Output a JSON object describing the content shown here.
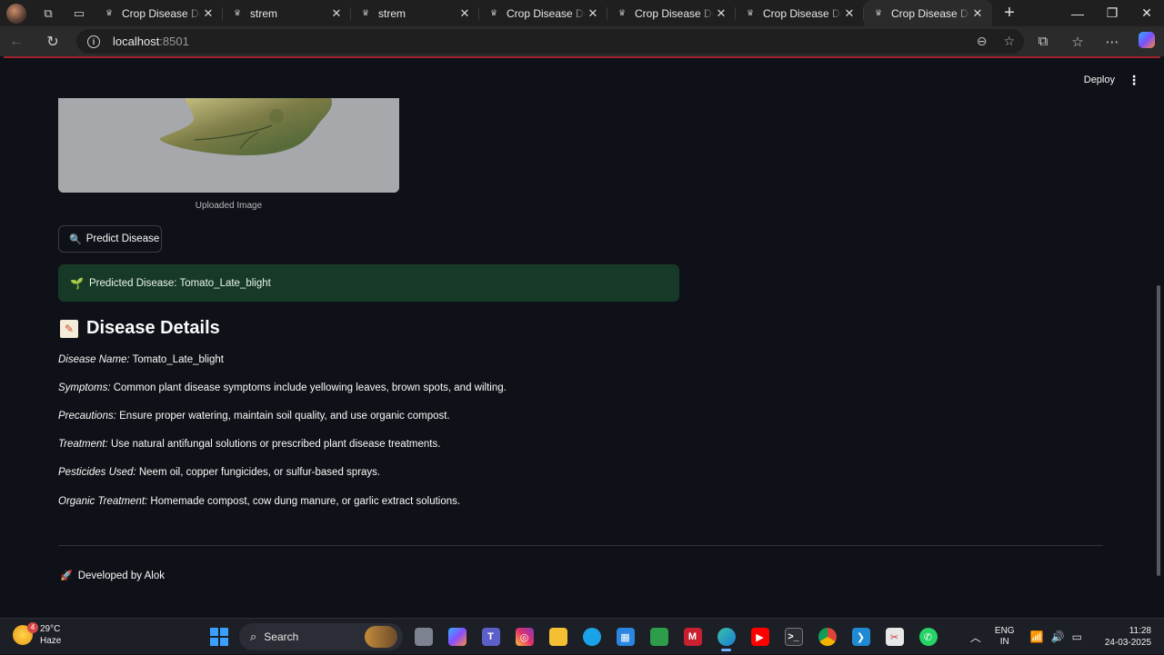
{
  "browser": {
    "tabs": [
      {
        "title": "Crop Disease Detecti",
        "active": false
      },
      {
        "title": "strem",
        "active": false
      },
      {
        "title": "strem",
        "active": false
      },
      {
        "title": "Crop Disease Detecti",
        "active": false
      },
      {
        "title": "Crop Disease Detecti",
        "active": false
      },
      {
        "title": "Crop Disease Detecti",
        "active": false
      },
      {
        "title": "Crop Disease Detecti",
        "active": true
      }
    ],
    "url_host": "localhost",
    "url_port": ":8501"
  },
  "app": {
    "toolbar": {
      "deploy_label": "Deploy"
    },
    "image_caption": "Uploaded Image",
    "predict_button_label": "Predict Disease",
    "prediction_text": "Predicted Disease: Tomato_Late_blight",
    "details_heading": "Disease Details",
    "details": [
      {
        "key": "Disease Name:",
        "value": " Tomato_Late_blight"
      },
      {
        "key": "Symptoms:",
        "value": " Common plant disease symptoms include yellowing leaves, brown spots, and wilting."
      },
      {
        "key": "Precautions:",
        "value": " Ensure proper watering, maintain soil quality, and use organic compost."
      },
      {
        "key": "Treatment:",
        "value": " Use natural antifungal solutions or prescribed plant disease treatments."
      },
      {
        "key": "Pesticides Used:",
        "value": " Neem oil, copper fungicides, or sulfur-based sprays."
      },
      {
        "key": "Organic Treatment:",
        "value": " Homemade compost, cow dung manure, or garlic extract solutions."
      }
    ],
    "footer_text": "Developed by Alok",
    "colors": {
      "background": "#0e1117",
      "success_bg": "#173928",
      "header_accent": "#a0202d"
    }
  },
  "taskbar": {
    "weather_temp": "29°C",
    "weather_desc": "Haze",
    "weather_badge": "4",
    "search_label": "Search",
    "lang_line1": "ENG",
    "lang_line2": "IN",
    "time": "11:28",
    "date": "24-03-2025"
  }
}
